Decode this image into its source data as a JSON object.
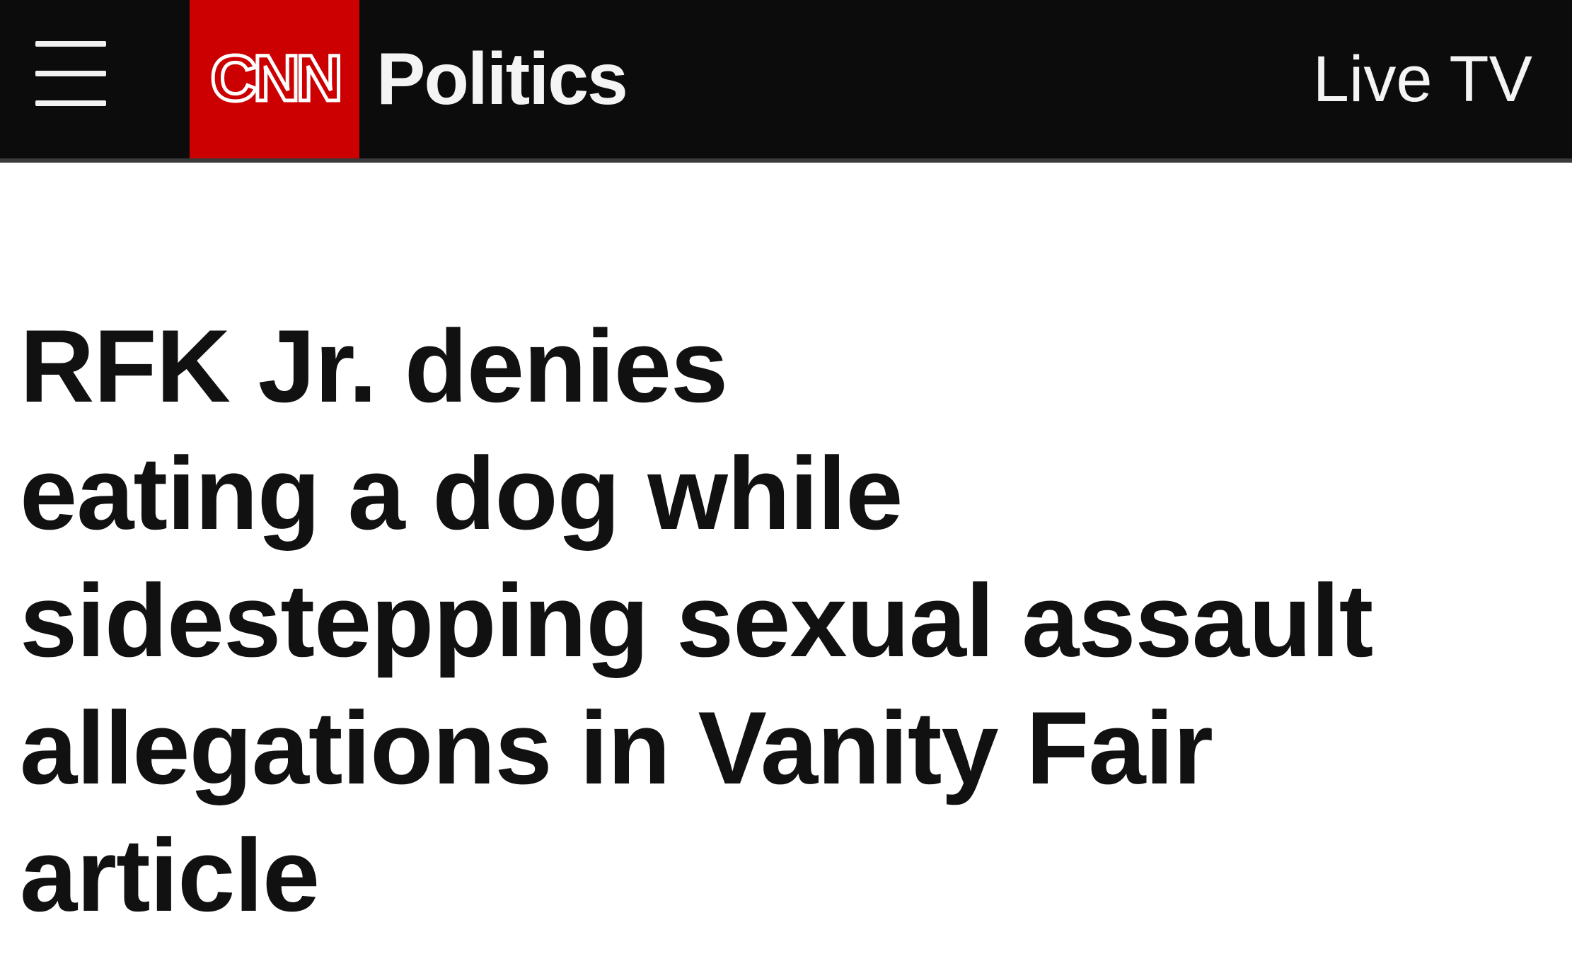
{
  "header": {
    "menu_icon": "hamburger-menu-icon",
    "logo_text": "CNN",
    "logo_color": "#cc0000",
    "section": "Politics",
    "live_tv_label": "Live TV",
    "background_color": "#0c0c0c"
  },
  "article": {
    "headline_lines": [
      "RFK Jr. denies",
      "eating a dog while",
      "sidestepping sexual assault",
      "allegations in Vanity Fair",
      "article"
    ]
  }
}
